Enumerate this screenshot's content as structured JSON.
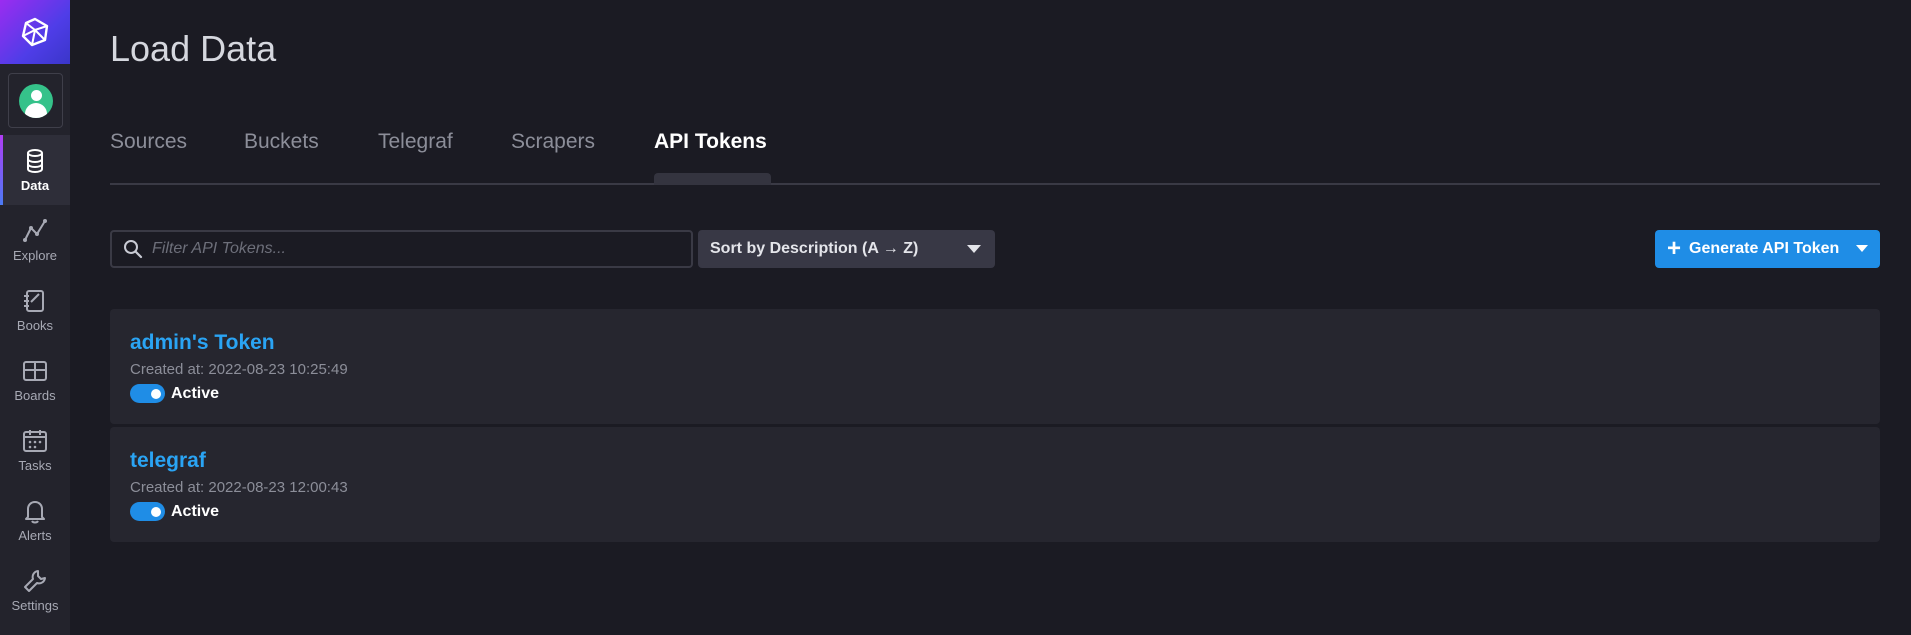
{
  "sidebar": {
    "items": [
      {
        "label": "Data",
        "icon": "database-icon",
        "active": true
      },
      {
        "label": "Explore",
        "icon": "graph-icon"
      },
      {
        "label": "Books",
        "icon": "notebook-icon"
      },
      {
        "label": "Boards",
        "icon": "dashboard-icon"
      },
      {
        "label": "Tasks",
        "icon": "calendar-icon"
      },
      {
        "label": "Alerts",
        "icon": "bell-icon"
      },
      {
        "label": "Settings",
        "icon": "wrench-icon"
      }
    ]
  },
  "page": {
    "title": "Load Data"
  },
  "tabs": [
    {
      "label": "Sources"
    },
    {
      "label": "Buckets"
    },
    {
      "label": "Telegraf"
    },
    {
      "label": "Scrapers"
    },
    {
      "label": "API Tokens",
      "active": true
    }
  ],
  "toolbar": {
    "filter_placeholder": "Filter API Tokens...",
    "sort_label": "Sort by Description (A → Z)",
    "generate_label": "Generate API Token"
  },
  "tokens": [
    {
      "name": "admin's Token",
      "created": "Created at: 2022-08-23 10:25:49",
      "status": "Active"
    },
    {
      "name": "telegraf",
      "created": "Created at: 2022-08-23 12:00:43",
      "status": "Active"
    }
  ],
  "colors": {
    "accent": "#1f8de6",
    "link": "#2aa4f4",
    "brand_start": "#9b2cf0",
    "brand_end": "#3a36c9"
  }
}
